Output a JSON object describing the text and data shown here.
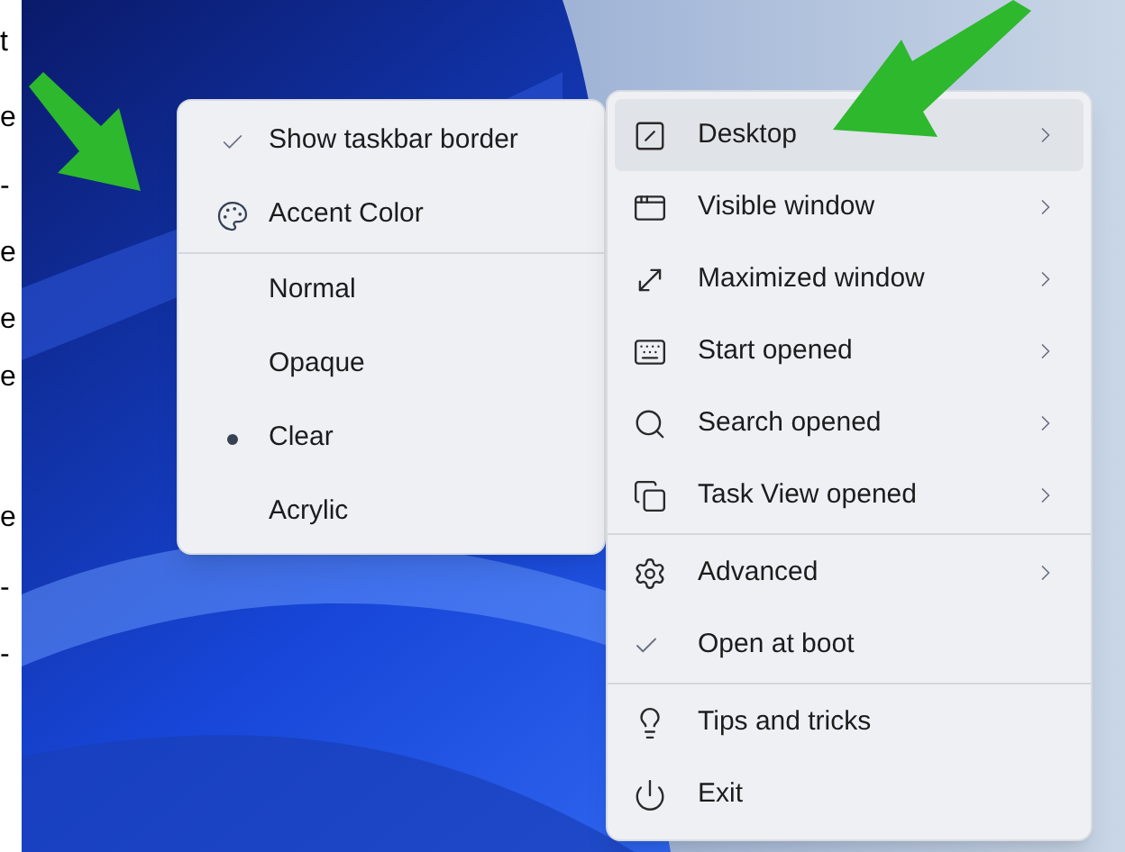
{
  "edge_text": [
    "t",
    "e",
    "-",
    "e",
    "e",
    "e",
    "e",
    "-",
    "-"
  ],
  "submenu": {
    "groups": [
      [
        {
          "label": "Show taskbar border",
          "kind": "check",
          "checked": true
        },
        {
          "label": "Accent Color",
          "kind": "icon"
        }
      ],
      [
        {
          "label": "Normal",
          "kind": "radio",
          "selected": false
        },
        {
          "label": "Opaque",
          "kind": "radio",
          "selected": false
        },
        {
          "label": "Clear",
          "kind": "radio",
          "selected": true
        },
        {
          "label": "Acrylic",
          "kind": "radio",
          "selected": false
        }
      ]
    ]
  },
  "main_menu": {
    "groups": [
      [
        {
          "label": "Desktop",
          "kind": "submenu",
          "selected": true
        },
        {
          "label": "Visible window",
          "kind": "submenu",
          "selected": false
        },
        {
          "label": "Maximized window",
          "kind": "submenu",
          "selected": false
        },
        {
          "label": "Start opened",
          "kind": "submenu",
          "selected": false
        },
        {
          "label": "Search opened",
          "kind": "submenu",
          "selected": false
        },
        {
          "label": "Task View opened",
          "kind": "submenu",
          "selected": false
        }
      ],
      [
        {
          "label": "Advanced",
          "kind": "submenu",
          "selected": false
        },
        {
          "label": "Open at boot",
          "kind": "check",
          "checked": true,
          "selected": false
        }
      ],
      [
        {
          "label": "Tips and tricks",
          "kind": "action",
          "selected": false
        },
        {
          "label": "Exit",
          "kind": "action",
          "selected": false
        }
      ]
    ]
  }
}
